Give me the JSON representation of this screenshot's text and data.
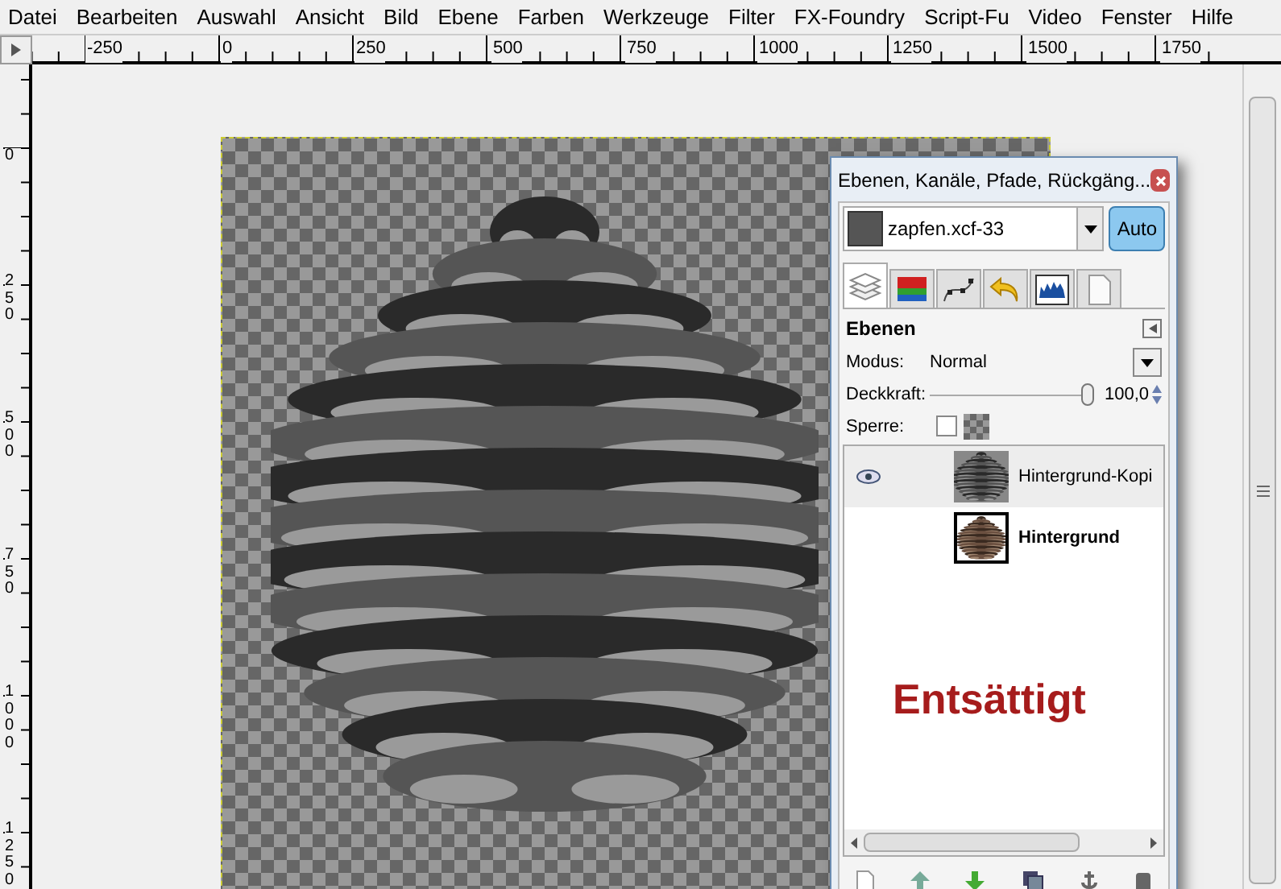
{
  "menu": [
    "Datei",
    "Bearbeiten",
    "Auswahl",
    "Ansicht",
    "Bild",
    "Ebene",
    "Farben",
    "Werkzeuge",
    "Filter",
    "FX-Foundry",
    "Script-Fu",
    "Video",
    "Fenster",
    "Hilfe"
  ],
  "ruler_h": [
    "-250",
    "0",
    "250",
    "500",
    "750",
    "1000",
    "1250",
    "1500",
    "1750"
  ],
  "ruler_v": [
    "0",
    "250",
    "500",
    "750",
    "1000",
    "1250"
  ],
  "dock": {
    "title": "Ebenen, Kanäle, Pfade, Rückgäng...",
    "image": "zapfen.xcf-33",
    "auto": {
      "label": "Auto",
      "on": true
    },
    "tabs": [
      {
        "kind": "layers",
        "selected": true
      },
      {
        "kind": "channels",
        "selected": false
      },
      {
        "kind": "paths",
        "selected": false
      },
      {
        "kind": "undo",
        "selected": false
      },
      {
        "kind": "histogram",
        "selected": false
      },
      {
        "kind": "document",
        "selected": false
      }
    ],
    "heading": "Ebenen",
    "mode_label": "Modus:",
    "mode": "Normal",
    "opacity_label": "Deckkraft:",
    "opacity": {
      "level": 1.0,
      "reading": "100,0"
    },
    "lock_label": "Sperre:",
    "lock_checked": false,
    "layers": [
      {
        "name": "Hintergrund-Kopi",
        "visible": true,
        "selected": true,
        "kind": "gray"
      },
      {
        "name": "Hintergrund",
        "visible": false,
        "selected": false,
        "kind": "color"
      }
    ],
    "annotation": "Entsättigt"
  }
}
